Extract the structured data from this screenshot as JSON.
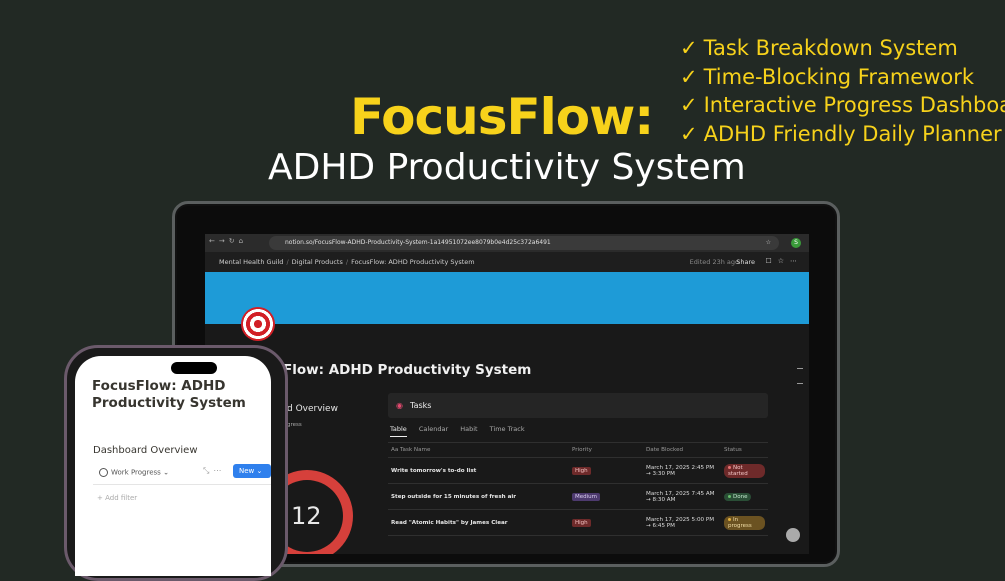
{
  "headline": {
    "title": "FocusFlow:",
    "subtitle": "ADHD Productivity System"
  },
  "features": [
    "Task Breakdown System",
    "Time-Blocking Framework",
    "Interactive Progress Dashboard",
    "ADHD Friendly Daily Planner"
  ],
  "browser": {
    "url": "notion.so/FocusFlow-ADHD-Productivity-System-1a14951072ee8079b0e4d25c372a6491",
    "avatar": "S"
  },
  "notion_bar": {
    "crumbs": [
      "Mental Health Guild",
      "Digital Products",
      "FocusFlow: ADHD Productivity System"
    ],
    "edited": "Edited 23h ago",
    "share": "Share"
  },
  "page": {
    "title": "Flow: ADHD Productivity System",
    "dashboard_overview": "d Overview",
    "progress_label": "gress",
    "ring_number": "12"
  },
  "tasks": {
    "heading": "Tasks",
    "views": [
      "Table",
      "Calendar",
      "Habit",
      "Time Track"
    ],
    "columns": [
      "Aa Task Name",
      "Priority",
      "Date Blocked",
      "Status"
    ],
    "rows": [
      {
        "name": "Write tomorrow's to-do list",
        "priority": "High",
        "date": "March 17, 2025 2:45 PM → 3:30 PM",
        "status": "Not started"
      },
      {
        "name": "Step outside for 15 minutes of fresh air",
        "priority": "Medium",
        "date": "March 17, 2025 7:45 AM → 8:30 AM",
        "status": "Done"
      },
      {
        "name": "Read \"Atomic Habits\" by James Clear",
        "priority": "High",
        "date": "March 17, 2025 5:00 PM → 6:45 PM",
        "status": "In progress"
      }
    ]
  },
  "phone": {
    "title": "FocusFlow: ADHD Productivity System",
    "dashboard": "Dashboard Overview",
    "view": "Work Progress",
    "new_button": "New",
    "add_filter": "+ Add filter"
  },
  "colors": {
    "background": "#222924",
    "accent_yellow": "#f7d21b",
    "banner_blue": "#1e9bd7",
    "new_button_blue": "#2f80ed"
  }
}
